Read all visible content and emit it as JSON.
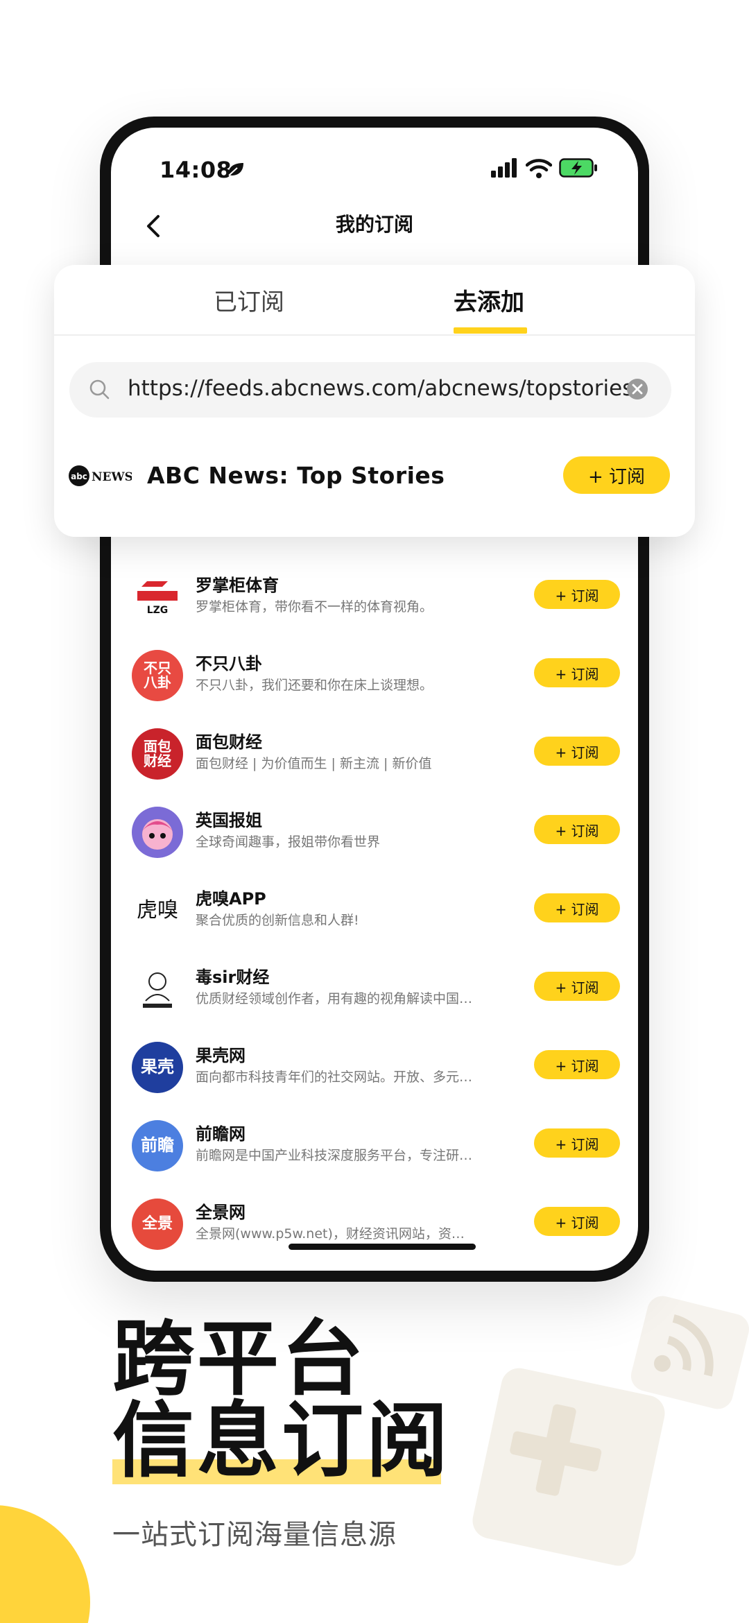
{
  "status": {
    "time": "14:08"
  },
  "nav": {
    "title": "我的订阅"
  },
  "tabs": [
    {
      "label": "已订阅"
    },
    {
      "label": "去添加"
    }
  ],
  "search": {
    "value": "https://feeds.abcnews.com/abcnews/topstories"
  },
  "result": {
    "name": "ABC News: Top Stories",
    "button": "+ 订阅"
  },
  "feeds": [
    {
      "name": "罗掌柜体育",
      "desc": "罗掌柜体育，带你看不一样的体育视角。",
      "button": "+ 订阅",
      "logo_color": "#ffffff",
      "logo_text": "LZG"
    },
    {
      "name": "不只八卦",
      "desc": "不只八卦，我们还要和你在床上谈理想。",
      "button": "+ 订阅",
      "logo_color": "#e84a42",
      "logo_text": "不只\n八卦"
    },
    {
      "name": "面包财经",
      "desc": "面包财经 | 为价值而生 | 新主流 | 新价值",
      "button": "+ 订阅",
      "logo_color": "#c9232b",
      "logo_text": "面包\n财经"
    },
    {
      "name": "英国报姐",
      "desc": "全球奇闻趣事，报姐带你看世界",
      "button": "+ 订阅",
      "logo_color": "#7b6bd6",
      "logo_text": ""
    },
    {
      "name": "虎嗅APP",
      "desc": "聚合优质的创新信息和人群!",
      "button": "+ 订阅",
      "logo_color": "#ffffff",
      "logo_text": "虎嗅"
    },
    {
      "name": "毒sir财经",
      "desc": "优质财经领域创作者，用有趣的视角解读中国…",
      "button": "+ 订阅",
      "logo_color": "#ffffff",
      "logo_text": ""
    },
    {
      "name": "果壳网",
      "desc": "面向都市科技青年们的社交网站。开放、多元…",
      "button": "+ 订阅",
      "logo_color": "#1f3e9e",
      "logo_text": "果壳"
    },
    {
      "name": "前瞻网",
      "desc": "前瞻网是中国产业科技深度服务平台，专注研…",
      "button": "+ 订阅",
      "logo_color": "#4c7fe0",
      "logo_text": "前瞻"
    },
    {
      "name": "全景网",
      "desc": "全景网(www.p5w.net)，财经资讯网站，资…",
      "button": "+ 订阅",
      "logo_color": "#e64a3c",
      "logo_text": "全景"
    }
  ],
  "hero": {
    "line1": "跨平台",
    "line2": "信息订阅",
    "subtitle": "一站式订阅海量信息源"
  },
  "colors": {
    "accent": "#ffd21c"
  }
}
